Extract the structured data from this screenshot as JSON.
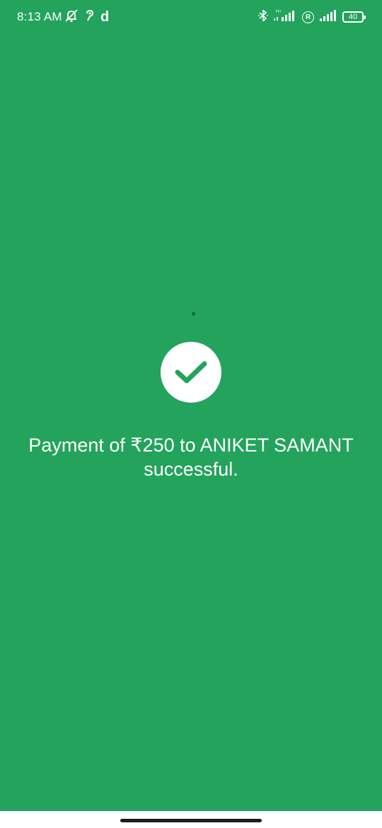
{
  "status_bar": {
    "time": "8:13 AM",
    "app_letter": "d",
    "network_type": "H+",
    "roaming_badge": "R",
    "battery_level": "40"
  },
  "payment": {
    "message": "Payment of ₹250 to ANIKET SAMANT successful.",
    "status": "success"
  },
  "colors": {
    "background": "#23a35c",
    "check": "#23a35c",
    "text": "#ffffff"
  },
  "icons": {
    "success": "check-circle-icon"
  }
}
